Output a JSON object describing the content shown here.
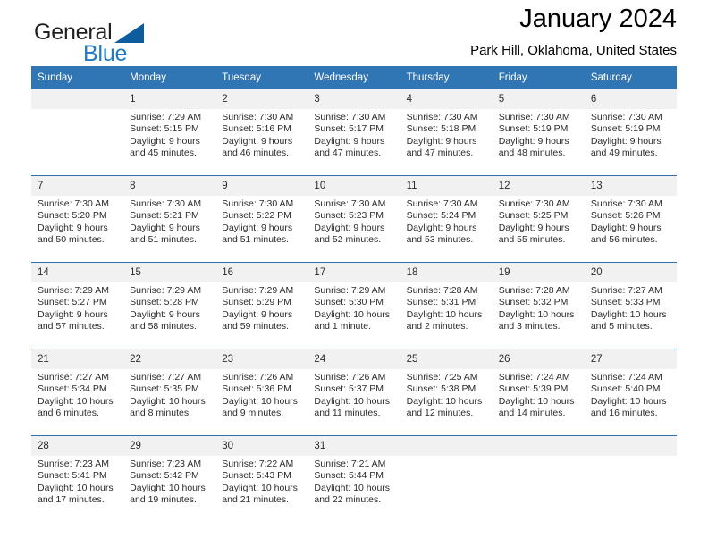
{
  "brand": {
    "name_part1": "General",
    "name_part2": "Blue",
    "triangle_icon": "blue-triangle-icon",
    "color_dark": "#231f20",
    "color_blue": "#1e7ac4",
    "color_triangle": "#0d5c9e"
  },
  "header": {
    "title": "January 2024",
    "subtitle": "Park Hill, Oklahoma, United States",
    "accent_color": "#3075b4"
  },
  "calendar": {
    "weekdays": [
      "Sunday",
      "Monday",
      "Tuesday",
      "Wednesday",
      "Thursday",
      "Friday",
      "Saturday"
    ],
    "weeks": [
      [
        {
          "day": "",
          "sunrise": "",
          "sunset": "",
          "daylight_line1": "",
          "daylight_line2": ""
        },
        {
          "day": "1",
          "sunrise": "Sunrise: 7:29 AM",
          "sunset": "Sunset: 5:15 PM",
          "daylight_line1": "Daylight: 9 hours",
          "daylight_line2": "and 45 minutes."
        },
        {
          "day": "2",
          "sunrise": "Sunrise: 7:30 AM",
          "sunset": "Sunset: 5:16 PM",
          "daylight_line1": "Daylight: 9 hours",
          "daylight_line2": "and 46 minutes."
        },
        {
          "day": "3",
          "sunrise": "Sunrise: 7:30 AM",
          "sunset": "Sunset: 5:17 PM",
          "daylight_line1": "Daylight: 9 hours",
          "daylight_line2": "and 47 minutes."
        },
        {
          "day": "4",
          "sunrise": "Sunrise: 7:30 AM",
          "sunset": "Sunset: 5:18 PM",
          "daylight_line1": "Daylight: 9 hours",
          "daylight_line2": "and 47 minutes."
        },
        {
          "day": "5",
          "sunrise": "Sunrise: 7:30 AM",
          "sunset": "Sunset: 5:19 PM",
          "daylight_line1": "Daylight: 9 hours",
          "daylight_line2": "and 48 minutes."
        },
        {
          "day": "6",
          "sunrise": "Sunrise: 7:30 AM",
          "sunset": "Sunset: 5:19 PM",
          "daylight_line1": "Daylight: 9 hours",
          "daylight_line2": "and 49 minutes."
        }
      ],
      [
        {
          "day": "7",
          "sunrise": "Sunrise: 7:30 AM",
          "sunset": "Sunset: 5:20 PM",
          "daylight_line1": "Daylight: 9 hours",
          "daylight_line2": "and 50 minutes."
        },
        {
          "day": "8",
          "sunrise": "Sunrise: 7:30 AM",
          "sunset": "Sunset: 5:21 PM",
          "daylight_line1": "Daylight: 9 hours",
          "daylight_line2": "and 51 minutes."
        },
        {
          "day": "9",
          "sunrise": "Sunrise: 7:30 AM",
          "sunset": "Sunset: 5:22 PM",
          "daylight_line1": "Daylight: 9 hours",
          "daylight_line2": "and 51 minutes."
        },
        {
          "day": "10",
          "sunrise": "Sunrise: 7:30 AM",
          "sunset": "Sunset: 5:23 PM",
          "daylight_line1": "Daylight: 9 hours",
          "daylight_line2": "and 52 minutes."
        },
        {
          "day": "11",
          "sunrise": "Sunrise: 7:30 AM",
          "sunset": "Sunset: 5:24 PM",
          "daylight_line1": "Daylight: 9 hours",
          "daylight_line2": "and 53 minutes."
        },
        {
          "day": "12",
          "sunrise": "Sunrise: 7:30 AM",
          "sunset": "Sunset: 5:25 PM",
          "daylight_line1": "Daylight: 9 hours",
          "daylight_line2": "and 55 minutes."
        },
        {
          "day": "13",
          "sunrise": "Sunrise: 7:30 AM",
          "sunset": "Sunset: 5:26 PM",
          "daylight_line1": "Daylight: 9 hours",
          "daylight_line2": "and 56 minutes."
        }
      ],
      [
        {
          "day": "14",
          "sunrise": "Sunrise: 7:29 AM",
          "sunset": "Sunset: 5:27 PM",
          "daylight_line1": "Daylight: 9 hours",
          "daylight_line2": "and 57 minutes."
        },
        {
          "day": "15",
          "sunrise": "Sunrise: 7:29 AM",
          "sunset": "Sunset: 5:28 PM",
          "daylight_line1": "Daylight: 9 hours",
          "daylight_line2": "and 58 minutes."
        },
        {
          "day": "16",
          "sunrise": "Sunrise: 7:29 AM",
          "sunset": "Sunset: 5:29 PM",
          "daylight_line1": "Daylight: 9 hours",
          "daylight_line2": "and 59 minutes."
        },
        {
          "day": "17",
          "sunrise": "Sunrise: 7:29 AM",
          "sunset": "Sunset: 5:30 PM",
          "daylight_line1": "Daylight: 10 hours",
          "daylight_line2": "and 1 minute."
        },
        {
          "day": "18",
          "sunrise": "Sunrise: 7:28 AM",
          "sunset": "Sunset: 5:31 PM",
          "daylight_line1": "Daylight: 10 hours",
          "daylight_line2": "and 2 minutes."
        },
        {
          "day": "19",
          "sunrise": "Sunrise: 7:28 AM",
          "sunset": "Sunset: 5:32 PM",
          "daylight_line1": "Daylight: 10 hours",
          "daylight_line2": "and 3 minutes."
        },
        {
          "day": "20",
          "sunrise": "Sunrise: 7:27 AM",
          "sunset": "Sunset: 5:33 PM",
          "daylight_line1": "Daylight: 10 hours",
          "daylight_line2": "and 5 minutes."
        }
      ],
      [
        {
          "day": "21",
          "sunrise": "Sunrise: 7:27 AM",
          "sunset": "Sunset: 5:34 PM",
          "daylight_line1": "Daylight: 10 hours",
          "daylight_line2": "and 6 minutes."
        },
        {
          "day": "22",
          "sunrise": "Sunrise: 7:27 AM",
          "sunset": "Sunset: 5:35 PM",
          "daylight_line1": "Daylight: 10 hours",
          "daylight_line2": "and 8 minutes."
        },
        {
          "day": "23",
          "sunrise": "Sunrise: 7:26 AM",
          "sunset": "Sunset: 5:36 PM",
          "daylight_line1": "Daylight: 10 hours",
          "daylight_line2": "and 9 minutes."
        },
        {
          "day": "24",
          "sunrise": "Sunrise: 7:26 AM",
          "sunset": "Sunset: 5:37 PM",
          "daylight_line1": "Daylight: 10 hours",
          "daylight_line2": "and 11 minutes."
        },
        {
          "day": "25",
          "sunrise": "Sunrise: 7:25 AM",
          "sunset": "Sunset: 5:38 PM",
          "daylight_line1": "Daylight: 10 hours",
          "daylight_line2": "and 12 minutes."
        },
        {
          "day": "26",
          "sunrise": "Sunrise: 7:24 AM",
          "sunset": "Sunset: 5:39 PM",
          "daylight_line1": "Daylight: 10 hours",
          "daylight_line2": "and 14 minutes."
        },
        {
          "day": "27",
          "sunrise": "Sunrise: 7:24 AM",
          "sunset": "Sunset: 5:40 PM",
          "daylight_line1": "Daylight: 10 hours",
          "daylight_line2": "and 16 minutes."
        }
      ],
      [
        {
          "day": "28",
          "sunrise": "Sunrise: 7:23 AM",
          "sunset": "Sunset: 5:41 PM",
          "daylight_line1": "Daylight: 10 hours",
          "daylight_line2": "and 17 minutes."
        },
        {
          "day": "29",
          "sunrise": "Sunrise: 7:23 AM",
          "sunset": "Sunset: 5:42 PM",
          "daylight_line1": "Daylight: 10 hours",
          "daylight_line2": "and 19 minutes."
        },
        {
          "day": "30",
          "sunrise": "Sunrise: 7:22 AM",
          "sunset": "Sunset: 5:43 PM",
          "daylight_line1": "Daylight: 10 hours",
          "daylight_line2": "and 21 minutes."
        },
        {
          "day": "31",
          "sunrise": "Sunrise: 7:21 AM",
          "sunset": "Sunset: 5:44 PM",
          "daylight_line1": "Daylight: 10 hours",
          "daylight_line2": "and 22 minutes."
        },
        {
          "day": "",
          "sunrise": "",
          "sunset": "",
          "daylight_line1": "",
          "daylight_line2": ""
        },
        {
          "day": "",
          "sunrise": "",
          "sunset": "",
          "daylight_line1": "",
          "daylight_line2": ""
        },
        {
          "day": "",
          "sunrise": "",
          "sunset": "",
          "daylight_line1": "",
          "daylight_line2": ""
        }
      ]
    ]
  }
}
